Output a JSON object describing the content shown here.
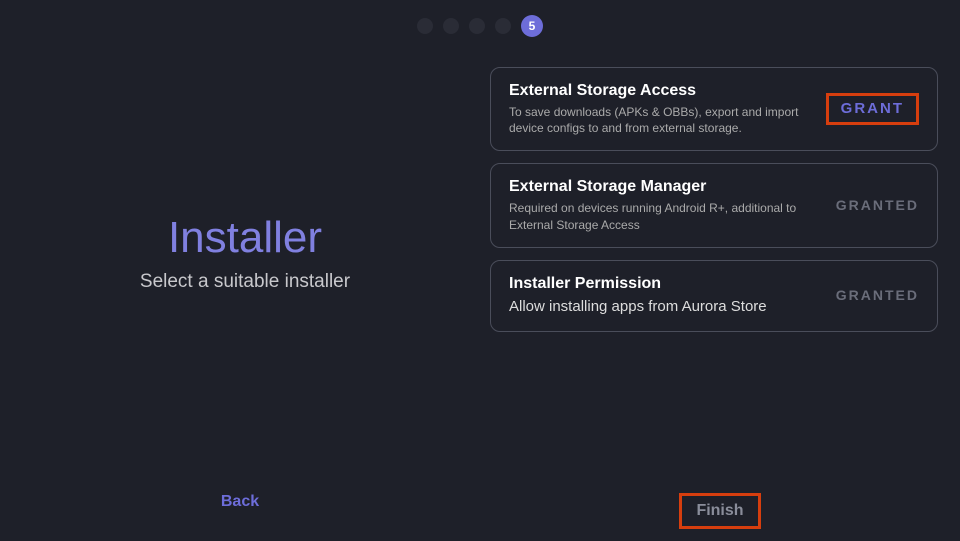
{
  "stepper": {
    "current": "5"
  },
  "left": {
    "title": "Installer",
    "subtitle": "Select a suitable installer"
  },
  "permissions": [
    {
      "title": "External Storage Access",
      "desc": "To save downloads (APKs & OBBs), export and import device configs to and from external storage.",
      "action": "GRANT",
      "granted": false,
      "highlighted": true
    },
    {
      "title": "External Storage Manager",
      "desc": "Required on devices running Android R+, additional to External Storage Access",
      "action": "GRANTED",
      "granted": true,
      "highlighted": false
    },
    {
      "title": "Installer Permission",
      "desc": "Allow installing apps from Aurora Store",
      "action": "GRANTED",
      "granted": true,
      "highlighted": false,
      "largeDesc": true
    }
  ],
  "nav": {
    "back": "Back",
    "finish": "Finish"
  }
}
